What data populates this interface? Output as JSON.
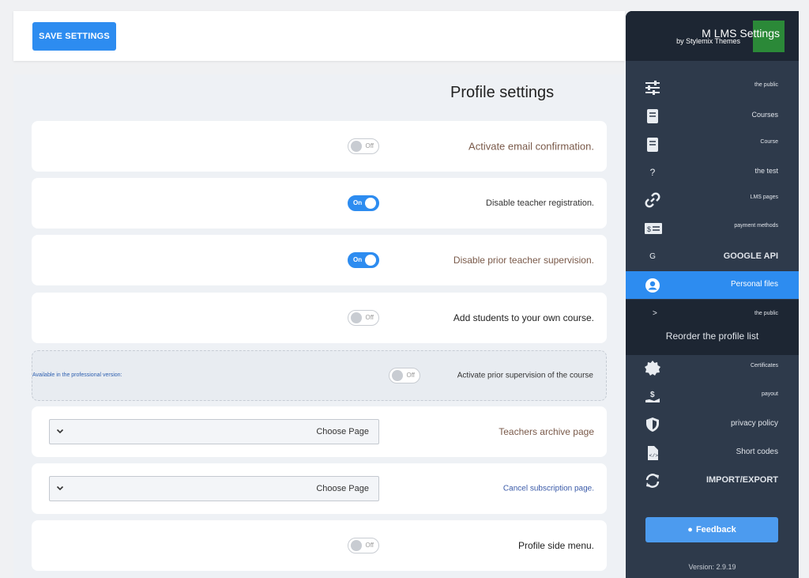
{
  "toolbar": {
    "save_label": "SAVE SETTINGS"
  },
  "page": {
    "title": "Profile settings"
  },
  "settings": [
    {
      "label": "Activate email confirmation.",
      "toggle": "Off"
    },
    {
      "label": "Disable teacher registration.",
      "toggle": "On"
    },
    {
      "label": "Disable prior teacher supervision.",
      "toggle": "On"
    },
    {
      "label": "Add students to your own course.",
      "toggle": "Off"
    },
    {
      "label": "Activate prior supervision of the course",
      "toggle": "Off",
      "note": "Available in the professional version:"
    },
    {
      "label": "Teachers archive page",
      "select": "Choose Page"
    },
    {
      "label": "Cancel subscription page.",
      "select": "Choose Page"
    },
    {
      "label": "Profile side menu.",
      "toggle": "Off"
    }
  ],
  "sidebar": {
    "title": "M LMS Settings",
    "subtitle": "by Stylemix Themes",
    "items": [
      {
        "label": "the public",
        "icon": "sliders-icon"
      },
      {
        "label": "Courses",
        "icon": "book-icon"
      },
      {
        "label": "Course",
        "icon": "book-icon"
      },
      {
        "label": "the test",
        "icon": "question-icon"
      },
      {
        "label": "LMS pages",
        "icon": "link-icon"
      },
      {
        "label": "payment methods",
        "icon": "money-icon"
      },
      {
        "label": "GOOGLE API",
        "icon": "google-icon"
      },
      {
        "label": "Personal files",
        "icon": "user-circle-icon"
      },
      {
        "label": "Certificates",
        "icon": "badge-icon"
      },
      {
        "label": "payout",
        "icon": "payout-icon"
      },
      {
        "label": "privacy policy",
        "icon": "shield-icon"
      },
      {
        "label": "Short codes",
        "icon": "code-file-icon"
      },
      {
        "label": "IMPORT/EXPORT",
        "icon": "sync-icon"
      }
    ],
    "submenu": {
      "parent": "the public",
      "item": "Reorder the profile list"
    },
    "feedback_label": "Feedback",
    "version": "Version: 2.9.19"
  },
  "colors": {
    "accent": "#2d8cf0",
    "sidebar_bg": "#2e3a4b",
    "sidebar_header": "#1d2633"
  }
}
